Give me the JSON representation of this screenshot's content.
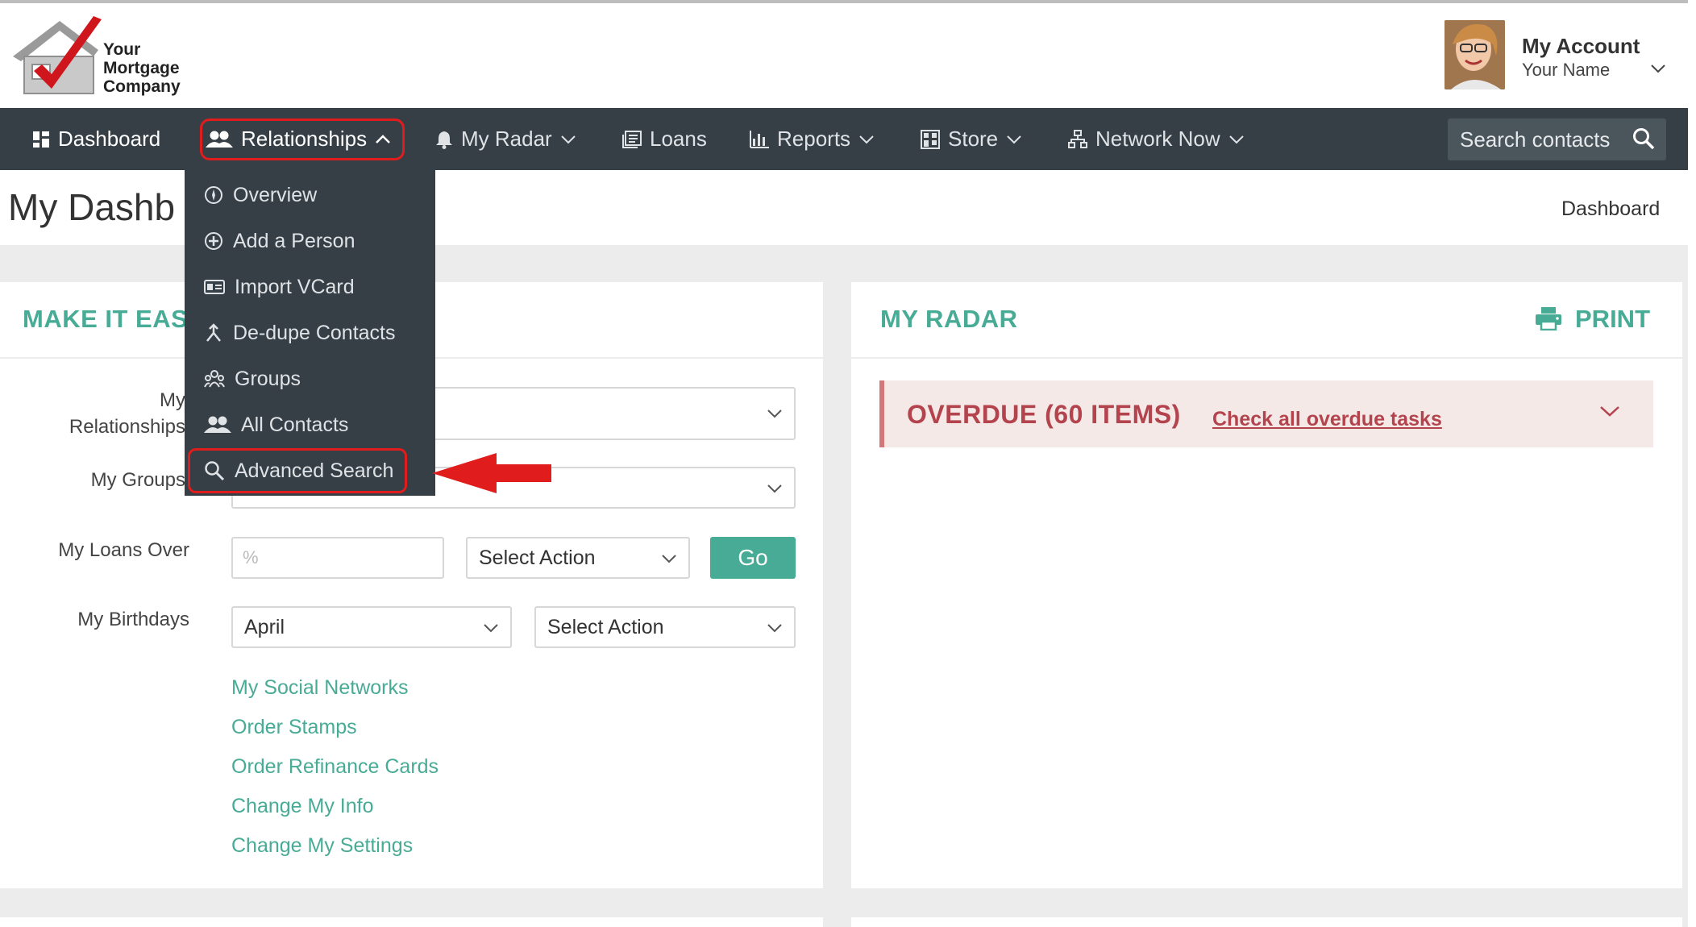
{
  "header": {
    "logo_text": [
      "Your",
      "Mortgage",
      "Company"
    ],
    "account_title": "My Account",
    "account_name": "Your Name"
  },
  "nav": {
    "items": [
      {
        "label": "Dashboard",
        "icon": "dashboard-icon"
      },
      {
        "label": "Relationships",
        "icon": "people-icon",
        "expanded": true
      },
      {
        "label": "My Radar",
        "icon": "bell-icon"
      },
      {
        "label": "Loans",
        "icon": "document-icon"
      },
      {
        "label": "Reports",
        "icon": "bar-chart-icon"
      },
      {
        "label": "Store",
        "icon": "store-icon"
      },
      {
        "label": "Network Now",
        "icon": "network-icon"
      }
    ],
    "search_placeholder": "Search contacts"
  },
  "page": {
    "title": "My Dashb",
    "breadcrumb": "Dashboard"
  },
  "relationships_menu": {
    "items": [
      {
        "label": "Overview",
        "icon": "compass-icon"
      },
      {
        "label": "Add a Person",
        "icon": "plus-circle-icon"
      },
      {
        "label": "Import VCard",
        "icon": "id-card-icon"
      },
      {
        "label": "De-dupe Contacts",
        "icon": "merge-icon"
      },
      {
        "label": "Groups",
        "icon": "group-icon"
      },
      {
        "label": "All Contacts",
        "icon": "people-icon"
      },
      {
        "label": "Advanced Search",
        "icon": "search-icon",
        "highlighted": true
      }
    ]
  },
  "make_it_easy": {
    "title": "MAKE IT EASY",
    "relationships_label_line1": "My",
    "relationships_label_line2": "Relationships",
    "groups_label": "My Groups",
    "loans_label": "My Loans Over",
    "loans_placeholder": "%",
    "loans_action": "Select Action",
    "go_label": "Go",
    "birthdays_label": "My Birthdays",
    "birthdays_month": "April",
    "birthdays_action": "Select Action",
    "links": [
      "My Social Networks",
      "Order Stamps",
      "Order Refinance Cards",
      "Change My Info",
      "Change My Settings"
    ]
  },
  "radar": {
    "title": "MY RADAR",
    "print_label": "PRINT",
    "overdue_title": "OVERDUE (60 ITEMS)",
    "overdue_link": "Check all overdue tasks"
  },
  "colors": {
    "accent": "#48ab96",
    "nav_bg": "#363f46",
    "overdue_text": "#b3444d",
    "highlight": "#e01c1c"
  }
}
